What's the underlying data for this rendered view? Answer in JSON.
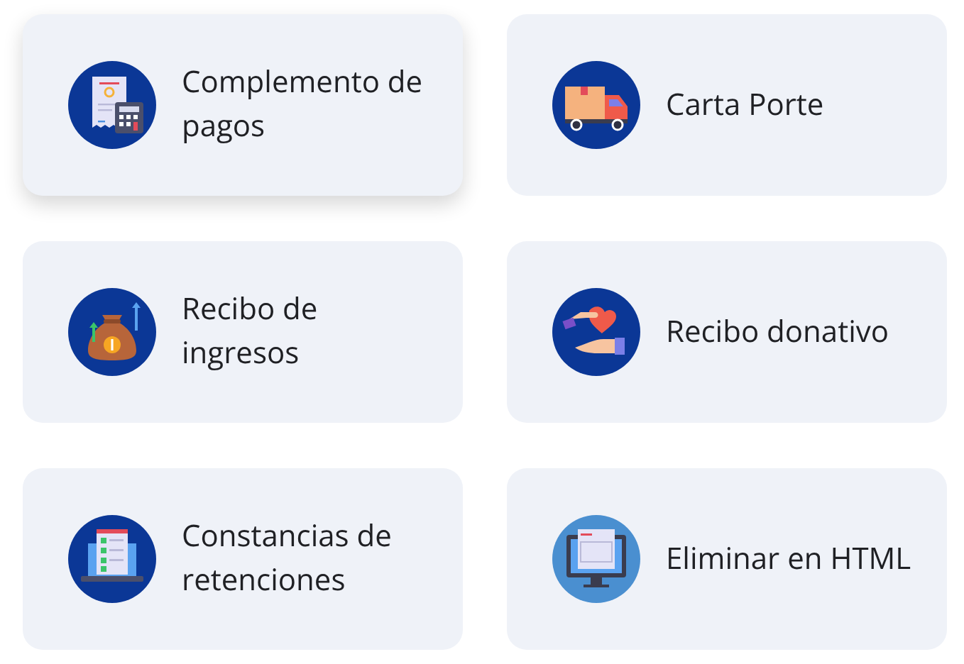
{
  "cards": [
    {
      "kind": "receipt",
      "label": "Complemento de pagos",
      "hovered": true
    },
    {
      "kind": "truck",
      "label": "Carta Porte",
      "hovered": false
    },
    {
      "kind": "moneybag",
      "label": "Recibo de ingresos",
      "hovered": false
    },
    {
      "kind": "donation",
      "label": "Recibo donativo",
      "hovered": false
    },
    {
      "kind": "laptop",
      "label": "Constancias de retenciones",
      "hovered": false
    },
    {
      "kind": "monitor",
      "label": "Eliminar en HTML",
      "hovered": false
    }
  ]
}
